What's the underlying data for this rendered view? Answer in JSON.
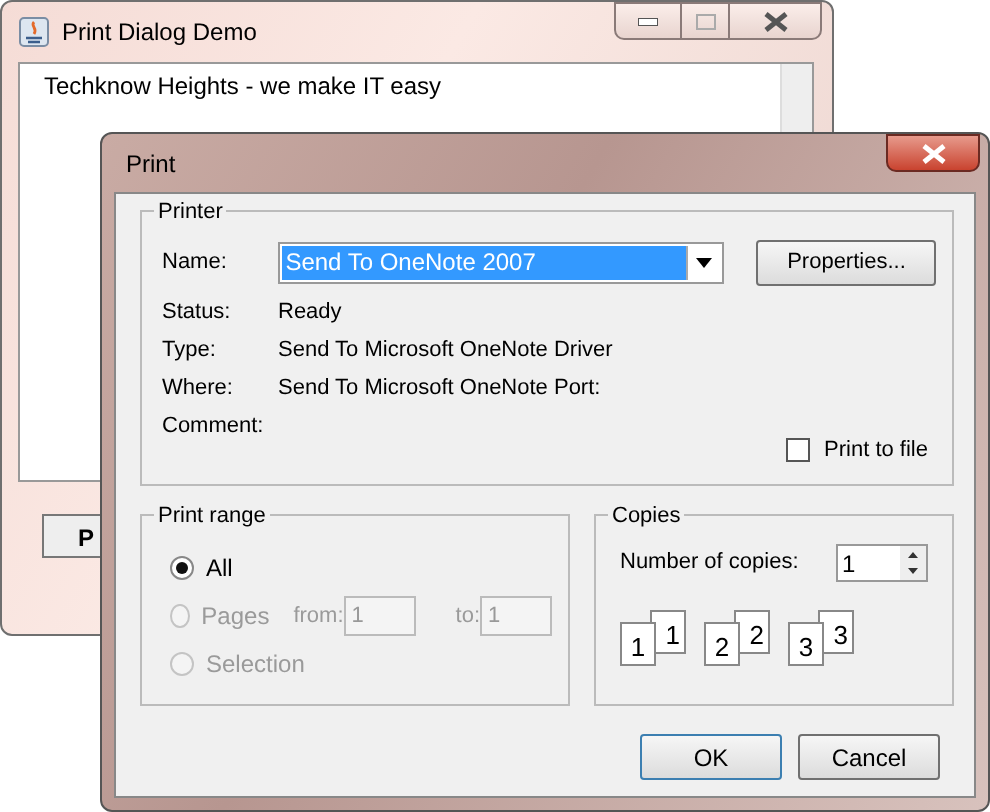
{
  "main_window": {
    "title": "Print Dialog Demo",
    "text": "Techknow Heights - we make IT easy",
    "button": "P"
  },
  "dialog": {
    "title": "Print",
    "printer": {
      "legend": "Printer",
      "name_label": "Name:",
      "name_value": "Send To OneNote 2007",
      "properties_button": "Properties...",
      "info": [
        {
          "label": "Status:",
          "value": "Ready"
        },
        {
          "label": "Type:",
          "value": "Send To Microsoft OneNote Driver"
        },
        {
          "label": "Where:",
          "value": "Send To Microsoft OneNote Port:"
        },
        {
          "label": "Comment:"
        }
      ],
      "print_to_file": {
        "label": "Print to file",
        "checked": false
      }
    },
    "print_range": {
      "legend": "Print range",
      "options": [
        {
          "label": "All",
          "selected": true,
          "disabled": false
        },
        {
          "label": "Pages",
          "selected": false,
          "disabled": true,
          "from_label": "from:",
          "from_value": "1",
          "to_label": "to:",
          "to_value": "1"
        },
        {
          "label": "Selection",
          "selected": false,
          "disabled": true
        }
      ]
    },
    "copies": {
      "legend": "Copies",
      "label": "Number of copies:",
      "value": "1",
      "pages": [
        {
          "front": "1",
          "back": "1"
        },
        {
          "front": "2",
          "back": "2"
        },
        {
          "front": "3",
          "back": "3"
        }
      ]
    },
    "buttons": [
      "OK",
      "Cancel"
    ]
  }
}
